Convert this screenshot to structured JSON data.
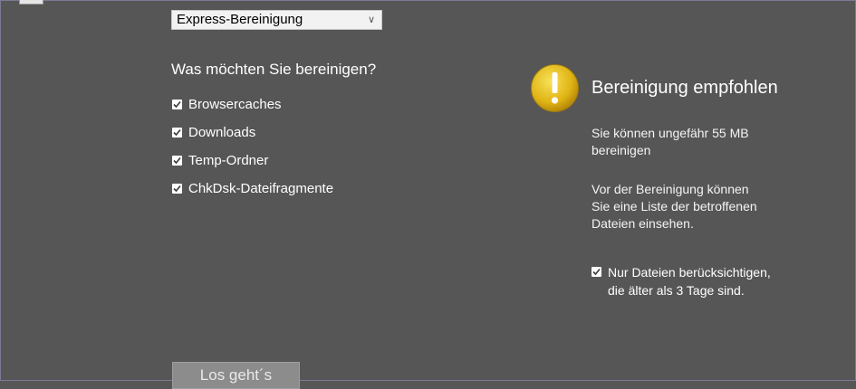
{
  "mode_select": {
    "value": "Express-Bereinigung"
  },
  "cleanup": {
    "heading": "Was möchten Sie bereinigen?",
    "options": [
      {
        "label": "Browsercaches",
        "checked": true
      },
      {
        "label": "Downloads",
        "checked": true
      },
      {
        "label": "Temp-Ordner",
        "checked": true
      },
      {
        "label": "ChkDsk-Dateifragmente",
        "checked": true
      }
    ]
  },
  "recommendation": {
    "icon": "warning-icon",
    "title": "Bereinigung empfohlen",
    "size_line1": "Sie können ungefähr 55 MB",
    "size_line2": "bereinigen",
    "list_line1": "Vor der Bereinigung können",
    "list_line2": "Sie eine Liste der betroffenen",
    "list_line3": "Dateien einsehen.",
    "older_line1": "Nur Dateien berücksichtigen,",
    "older_line2": "die älter als 3 Tage sind.",
    "older_checked": true
  },
  "start_button": {
    "label": "Los geht´s"
  },
  "colors": {
    "background": "#565656",
    "warning": "#e8c21a"
  }
}
